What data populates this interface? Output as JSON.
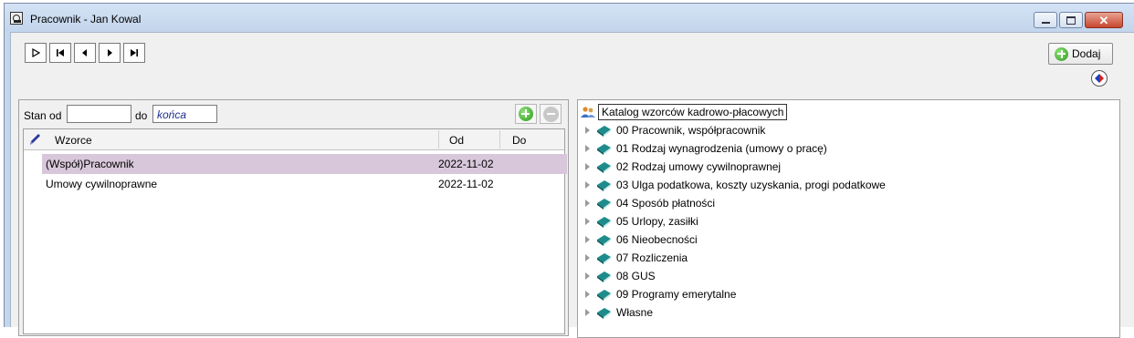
{
  "window": {
    "title": "Pracownik - Jan Kowal",
    "controls": {
      "minimize": "minimize",
      "maximize": "maximize",
      "close": "✕"
    }
  },
  "toolbar": {
    "nav_buttons": [
      "new-record",
      "first-record",
      "previous-record",
      "next-record",
      "last-record"
    ],
    "add_label": "Dodaj"
  },
  "filter": {
    "from_label": "Stan od",
    "from_value": "",
    "to_label": "do",
    "to_value": "końca"
  },
  "templates_table": {
    "columns": [
      "Wzorce",
      "Od",
      "Do"
    ],
    "rows": [
      {
        "name": "(Współ)Pracownik",
        "from": "2022-11-02",
        "to": "",
        "selected": true
      },
      {
        "name": "Umowy cywilnoprawne",
        "from": "2022-11-02",
        "to": "",
        "selected": false
      }
    ]
  },
  "catalog": {
    "root_label": "Katalog wzorców kadrowo-płacowych",
    "items": [
      "00 Pracownik, współpracownik",
      "01 Rodzaj wynagrodzenia (umowy o pracę)",
      "02 Rodzaj umowy cywilnoprawnej",
      "03 Ulga podatkowa, koszty uzyskania, progi podatkowe",
      "04 Sposób płatności",
      "05 Urlopy, zasiłki",
      "06 Nieobecności",
      "07 Rozliczenia",
      "08 GUS",
      "09 Programy emerytalne",
      "Własne"
    ]
  },
  "colors": {
    "window_frame": "#c4d6ee",
    "selected_row": "#d8c7da",
    "book_icon": "#1e8c8c",
    "add_green": "#2e9a1e"
  }
}
